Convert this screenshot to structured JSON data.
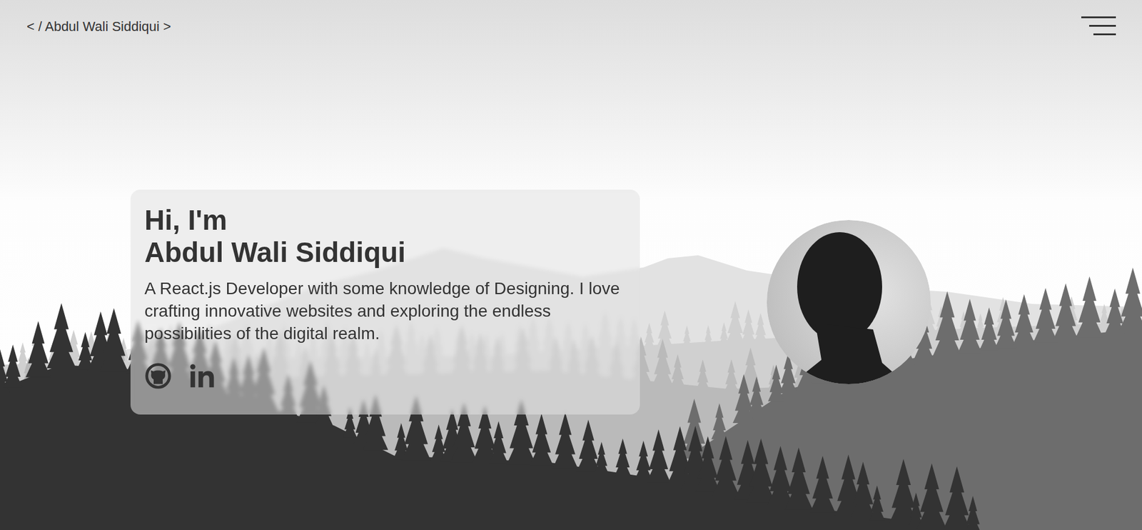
{
  "header": {
    "logo": "< / Abdul Wali Siddiqui >"
  },
  "hero": {
    "greeting": "Hi, I'm",
    "name": "Abdul Wali Siddiqui",
    "description": "A React.js Developer with some knowledge of Designing. I love crafting innovative websites and exploring the endless possibilities of the digital realm."
  },
  "social_links": [
    {
      "kind": "github"
    },
    {
      "kind": "linkedin"
    }
  ]
}
